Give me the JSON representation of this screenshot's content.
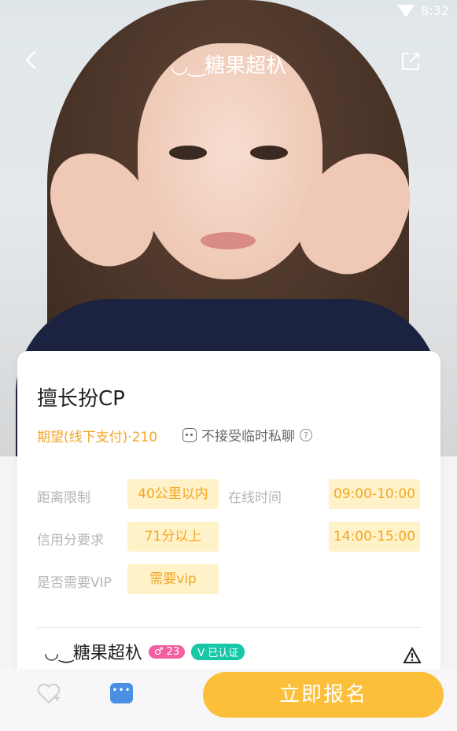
{
  "status_bar": {
    "time": "8:32"
  },
  "header": {
    "title": "◡‿糖果超杁",
    "back_icon": "chevron-left-icon",
    "share_icon": "share-icon"
  },
  "card": {
    "title": "擅长扮CP",
    "price": "期望(线下支付)·210",
    "no_chat": "不接受临时私聊",
    "rows": [
      {
        "label": "距离限制",
        "value": "40公里以内"
      },
      {
        "label": "在线时间",
        "value": "09:00-10:00"
      },
      {
        "label": "信用分要求",
        "value": "71分以上"
      },
      {
        "label": "",
        "value": "14:00-15:00"
      },
      {
        "label": "是否需要VIP",
        "value": "需要vip"
      }
    ],
    "user": {
      "name": "◡‿糖果超杁",
      "badge": "♂ 23",
      "verified": "V 已认证"
    }
  },
  "bottom": {
    "signup": "立即报名"
  }
}
